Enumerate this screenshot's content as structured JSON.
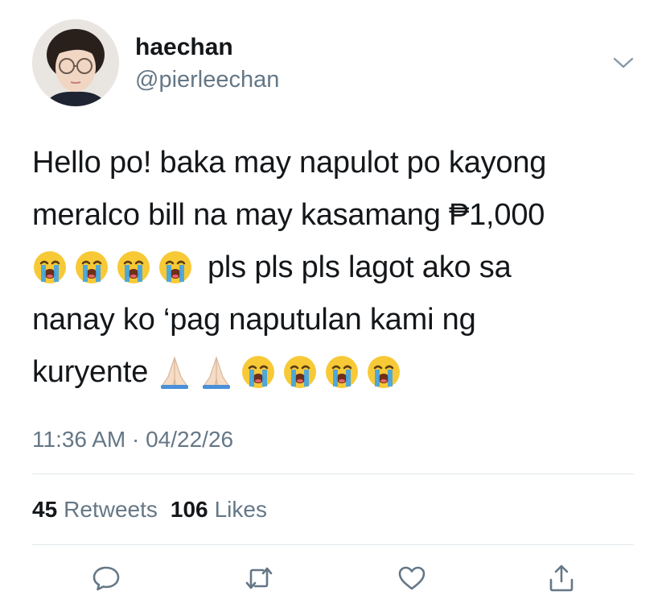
{
  "user": {
    "display_name": "haechan",
    "handle": "@pierleechan"
  },
  "tweet": {
    "line1": "Hello po! baka may napulot po kayong",
    "line2": "meralco bill na may kasamang ₱1,000",
    "line3_text": "pls pls pls lagot ako sa",
    "line4": "nanay ko ‘pag naputulan kami ng",
    "line5_text": "kuryente"
  },
  "meta": {
    "timestamp": "11:36 AM · 04/22/26"
  },
  "stats": {
    "retweets_count": "45",
    "retweets_label": "Retweets",
    "likes_count": "106",
    "likes_label": "Likes"
  },
  "colors": {
    "text": "#14171a",
    "secondary": "#657786",
    "divider": "#e1e8ed"
  },
  "icons": {
    "caret": "chevron-down-icon",
    "reply": "reply-icon",
    "retweet": "retweet-icon",
    "like": "heart-icon",
    "share": "share-icon",
    "crying_emoji": "loudly-crying-face-emoji",
    "praying_emoji": "folded-hands-emoji"
  }
}
